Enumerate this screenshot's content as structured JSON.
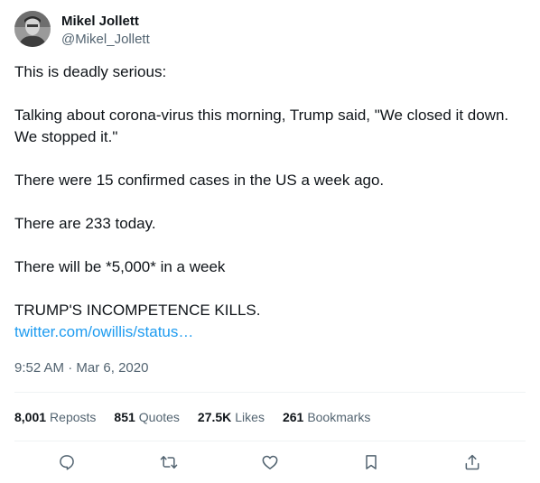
{
  "author": {
    "display_name": "Mikel Jollett",
    "handle": "@Mikel_Jollett"
  },
  "tweet": {
    "paragraphs": [
      "This is deadly serious:",
      "Talking about corona-virus this morning, Trump said, \"We closed it down. We stopped it.\"",
      "There were 15 confirmed cases in the US a week ago.",
      "There are 233 today.",
      "There will be *5,000* in a week"
    ],
    "last_line": "TRUMP'S INCOMPETENCE KILLS.",
    "link": "twitter.com/owillis/status…"
  },
  "meta": {
    "time": "9:52 AM",
    "separator": " · ",
    "date": "Mar 6, 2020"
  },
  "stats": {
    "reposts_count": "8,001",
    "reposts_label": "Reposts",
    "quotes_count": "851",
    "quotes_label": "Quotes",
    "likes_count": "27.5K",
    "likes_label": "Likes",
    "bookmarks_count": "261",
    "bookmarks_label": "Bookmarks"
  },
  "actions": [
    "reply-icon",
    "repost-icon",
    "like-icon",
    "bookmark-icon",
    "share-icon"
  ],
  "colors": {
    "text": "#0f1419",
    "secondary": "#536471",
    "link": "#1d9bf0",
    "divider": "#eff3f4"
  }
}
